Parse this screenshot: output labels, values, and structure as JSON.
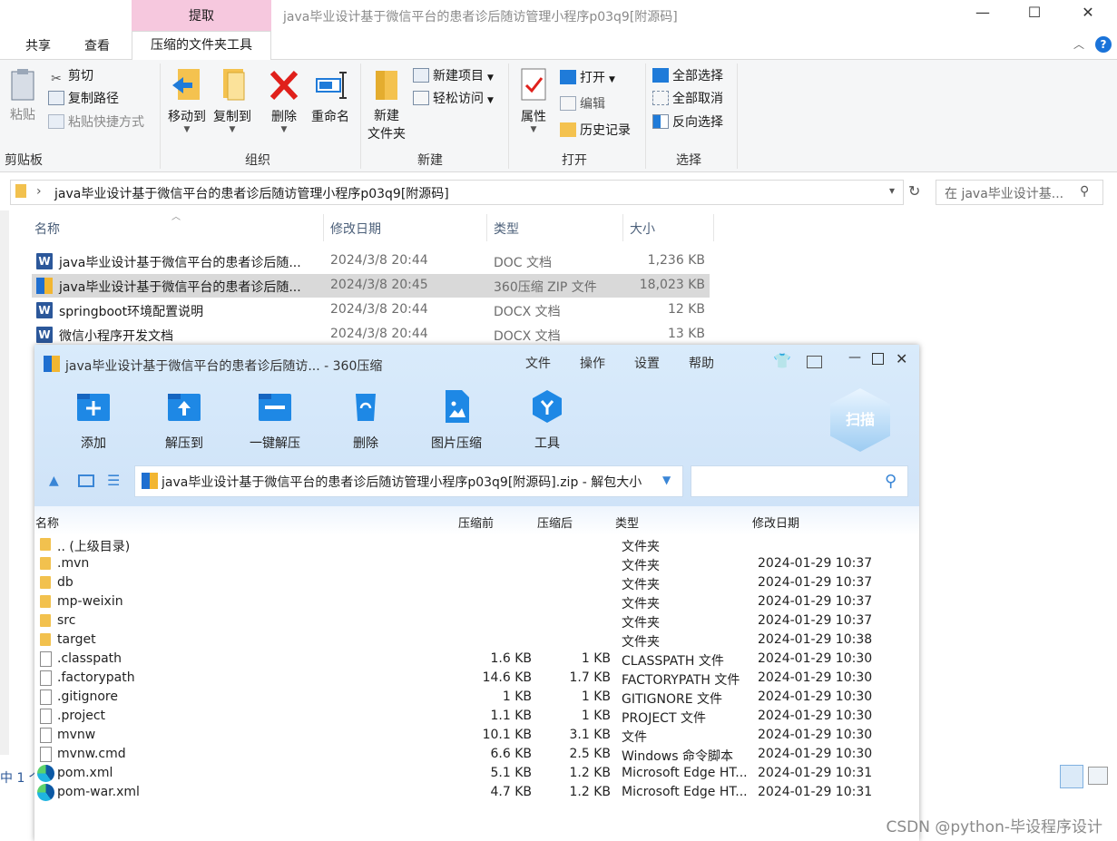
{
  "explorer": {
    "title": "java毕业设计基于微信平台的患者诊后随访管理小程序p03q9[附源码]",
    "context_tab": "提取",
    "window_controls": {
      "minimize": "—",
      "maximize": "☐",
      "close": "✕",
      "help": "?"
    },
    "tabs": [
      "共享",
      "查看",
      "压缩的文件夹工具"
    ],
    "ribbon": {
      "clipboard": {
        "label": "剪贴板",
        "paste": "粘贴",
        "cut": "剪切",
        "copy_path": "复制路径",
        "paste_shortcut": "粘贴快捷方式"
      },
      "organize": {
        "label": "组织",
        "move_to": "移动到",
        "copy_to": "复制到",
        "delete": "删除",
        "rename": "重命名"
      },
      "new": {
        "label": "新建",
        "new_folder": "新建\n文件夹",
        "new_item": "新建项目",
        "easy_access": "轻松访问"
      },
      "open": {
        "label": "打开",
        "properties": "属性",
        "open": "打开",
        "edit": "编辑",
        "history": "历史记录"
      },
      "select": {
        "label": "选择",
        "select_all": "全部选择",
        "select_none": "全部取消",
        "invert": "反向选择"
      }
    },
    "address": "java毕业设计基于微信平台的患者诊后随访管理小程序p03q9[附源码]",
    "search_placeholder": "在 java毕业设计基...",
    "columns": {
      "name": "名称",
      "date": "修改日期",
      "type": "类型",
      "size": "大小"
    },
    "files": [
      {
        "name": "java毕业设计基于微信平台的患者诊后随...",
        "date": "2024/3/8 20:44",
        "type": "DOC 文档",
        "size": "1,236 KB"
      },
      {
        "name": "java毕业设计基于微信平台的患者诊后随...",
        "date": "2024/3/8 20:45",
        "type": "360压缩 ZIP 文件",
        "size": "18,023 KB"
      },
      {
        "name": "springboot环境配置说明",
        "date": "2024/3/8 20:44",
        "type": "DOCX 文档",
        "size": "12 KB"
      },
      {
        "name": "微信小程序开发文档",
        "date": "2024/3/8 20:44",
        "type": "DOCX 文档",
        "size": "13 KB"
      }
    ],
    "status_left": "中 1 个"
  },
  "zip_window": {
    "title": "java毕业设计基于微信平台的患者诊后随访... - 360压缩",
    "menus": [
      "文件",
      "操作",
      "设置",
      "帮助"
    ],
    "tools": [
      "添加",
      "解压到",
      "一键解压",
      "删除",
      "图片压缩",
      "工具"
    ],
    "scan_label": "扫描",
    "path": "java毕业设计基于微信平台的患者诊后随访管理小程序p03q9[附源码].zip - 解包大小",
    "columns": {
      "name": "名称",
      "before": "压缩前",
      "after": "压缩后",
      "type": "类型",
      "date": "修改日期"
    },
    "rows": [
      {
        "icon": "folder",
        "name": ".. (上级目录)",
        "before": "",
        "after": "",
        "type": "文件夹",
        "date": ""
      },
      {
        "icon": "folder",
        "name": ".mvn",
        "before": "",
        "after": "",
        "type": "文件夹",
        "date": "2024-01-29 10:37"
      },
      {
        "icon": "folder",
        "name": "db",
        "before": "",
        "after": "",
        "type": "文件夹",
        "date": "2024-01-29 10:37"
      },
      {
        "icon": "folder",
        "name": "mp-weixin",
        "before": "",
        "after": "",
        "type": "文件夹",
        "date": "2024-01-29 10:37"
      },
      {
        "icon": "folder",
        "name": "src",
        "before": "",
        "after": "",
        "type": "文件夹",
        "date": "2024-01-29 10:37"
      },
      {
        "icon": "folder",
        "name": "target",
        "before": "",
        "after": "",
        "type": "文件夹",
        "date": "2024-01-29 10:38"
      },
      {
        "icon": "file",
        "name": ".classpath",
        "before": "1.6 KB",
        "after": "1 KB",
        "type": "CLASSPATH 文件",
        "date": "2024-01-29 10:30"
      },
      {
        "icon": "file",
        "name": ".factorypath",
        "before": "14.6 KB",
        "after": "1.7 KB",
        "type": "FACTORYPATH 文件",
        "date": "2024-01-29 10:30"
      },
      {
        "icon": "file",
        "name": ".gitignore",
        "before": "1 KB",
        "after": "1 KB",
        "type": "GITIGNORE 文件",
        "date": "2024-01-29 10:30"
      },
      {
        "icon": "file",
        "name": ".project",
        "before": "1.1 KB",
        "after": "1 KB",
        "type": "PROJECT 文件",
        "date": "2024-01-29 10:30"
      },
      {
        "icon": "file",
        "name": "mvnw",
        "before": "10.1 KB",
        "after": "3.1 KB",
        "type": "文件",
        "date": "2024-01-29 10:30"
      },
      {
        "icon": "file",
        "name": "mvnw.cmd",
        "before": "6.6 KB",
        "after": "2.5 KB",
        "type": "Windows 命令脚本",
        "date": "2024-01-29 10:30"
      },
      {
        "icon": "edge",
        "name": "pom.xml",
        "before": "5.1 KB",
        "after": "1.2 KB",
        "type": "Microsoft Edge HT...",
        "date": "2024-01-29 10:31"
      },
      {
        "icon": "edge",
        "name": "pom-war.xml",
        "before": "4.7 KB",
        "after": "1.2 KB",
        "type": "Microsoft Edge HT...",
        "date": "2024-01-29 10:31"
      }
    ]
  },
  "watermark": "CSDN @python-毕设程序设计"
}
